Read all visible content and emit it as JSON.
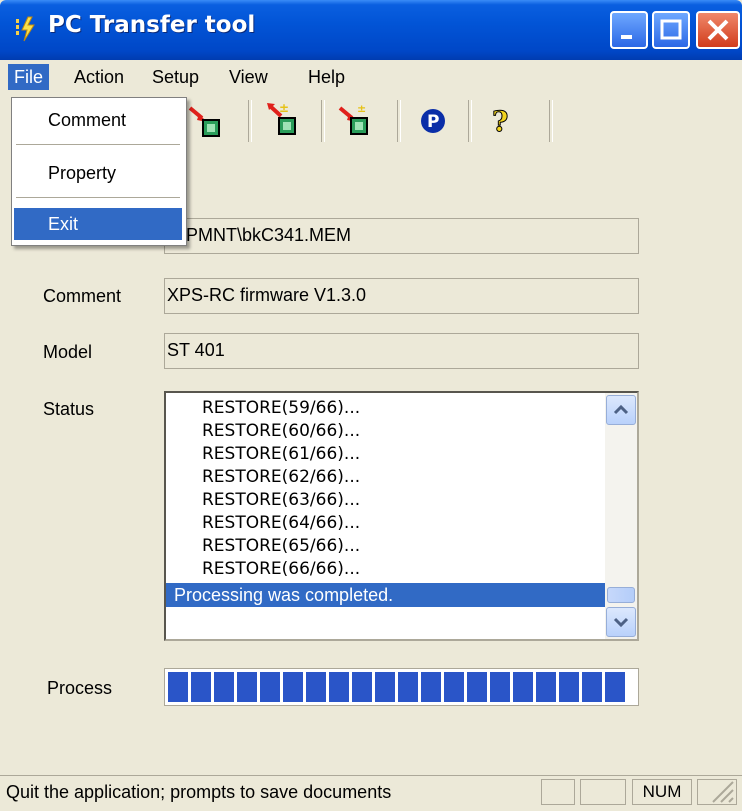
{
  "window": {
    "title": "PC Transfer tool"
  },
  "menubar": {
    "items": [
      "File",
      "Action",
      "Setup",
      "View",
      "Help"
    ]
  },
  "toolbar": {
    "icons": [
      "send-icon",
      "receive-icon",
      "compare-icon",
      "verify-icon",
      "parameter-icon",
      "help-icon"
    ]
  },
  "file_menu": {
    "items": [
      "Comment",
      "Property",
      "Exit"
    ],
    "selected": "Exit"
  },
  "form": {
    "file_value": "\\GPMNT\\bkC341.MEM",
    "comment_label": "Comment",
    "comment_value": "XPS-RC firmware V1.3.0",
    "model_label": "Model",
    "model_value": "ST 401",
    "status_label": "Status",
    "process_label": "Process"
  },
  "status_list": {
    "lines": [
      "RESTORE(59/66)...",
      "RESTORE(60/66)...",
      "RESTORE(61/66)...",
      "RESTORE(62/66)...",
      "RESTORE(63/66)...",
      "RESTORE(64/66)...",
      "RESTORE(65/66)...",
      "RESTORE(66/66)..."
    ],
    "selected_line": "Processing was completed."
  },
  "progress": {
    "fraction": 1.0
  },
  "statusbar": {
    "text": "Quit the application; prompts to save documents",
    "num": "NUM"
  },
  "colors": {
    "selection": "#316AC5",
    "titlebar": "#0254d6",
    "progress": "#2a55c8"
  }
}
